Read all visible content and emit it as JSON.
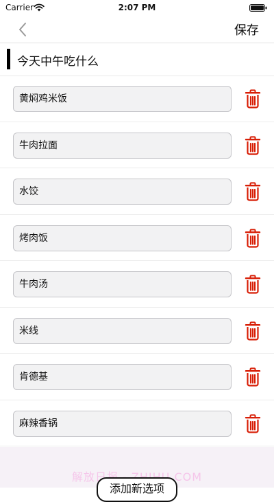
{
  "status_bar": {
    "carrier": "Carrier",
    "time": "2:07 PM"
  },
  "nav": {
    "back_icon": "chevron-left-icon",
    "save_label": "保存"
  },
  "page": {
    "title": "今天中午吃什么"
  },
  "options": [
    {
      "value": "黄焖鸡米饭"
    },
    {
      "value": "牛肉拉面"
    },
    {
      "value": "水饺"
    },
    {
      "value": "烤肉饭"
    },
    {
      "value": "牛肉汤"
    },
    {
      "value": "米线"
    },
    {
      "value": "肯德基"
    },
    {
      "value": "麻辣香锅"
    }
  ],
  "footer": {
    "add_option_label": "添加新选项",
    "watermark": "解放日报 - ZHIHU.COM"
  },
  "colors": {
    "delete_red": "#d81e06",
    "input_bg": "#f2f2f3",
    "footer_bg": "#f6f1f7"
  }
}
